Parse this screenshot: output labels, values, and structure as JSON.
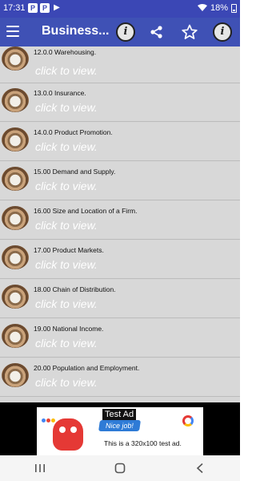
{
  "status_bar": {
    "time": "17:31",
    "notification_icons": [
      "P",
      "P",
      "play-icon"
    ],
    "battery": "18%"
  },
  "app_bar": {
    "title": "Business...",
    "accent_color": "#3f51b5"
  },
  "list": {
    "items": [
      {
        "title": "12.0.0 Warehousing.",
        "action": "click to view."
      },
      {
        "title": "13.0.0 Insurance.",
        "action": "click to view."
      },
      {
        "title": "14.0.0 Product Promotion.",
        "action": "click to view."
      },
      {
        "title": "15.00 Demand and Supply.",
        "action": "click to view."
      },
      {
        "title": "16.00 Size and Location of a Firm.",
        "action": "click to view."
      },
      {
        "title": "17.00 Product Markets.",
        "action": "click to view."
      },
      {
        "title": "18.00 Chain of Distribution.",
        "action": "click to view."
      },
      {
        "title": "19.00 National Income.",
        "action": "click to view."
      },
      {
        "title": "20.00 Population and Employment.",
        "action": "click to view."
      }
    ]
  },
  "ad": {
    "label": "Test Ad",
    "bubble": "Nice job!",
    "text": "This is a 320x100 test ad."
  }
}
